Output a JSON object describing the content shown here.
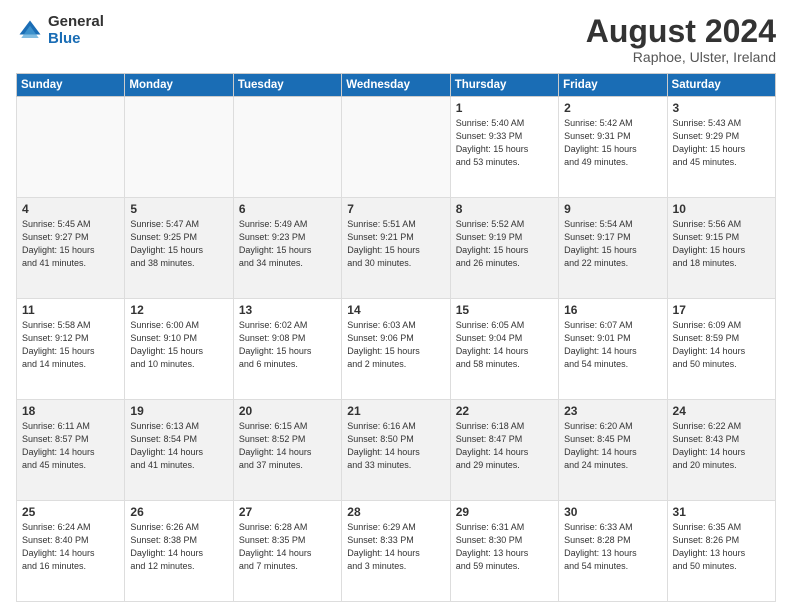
{
  "logo": {
    "general": "General",
    "blue": "Blue"
  },
  "header": {
    "month_year": "August 2024",
    "location": "Raphoe, Ulster, Ireland"
  },
  "weekdays": [
    "Sunday",
    "Monday",
    "Tuesday",
    "Wednesday",
    "Thursday",
    "Friday",
    "Saturday"
  ],
  "weeks": [
    [
      {
        "day": "",
        "info": ""
      },
      {
        "day": "",
        "info": ""
      },
      {
        "day": "",
        "info": ""
      },
      {
        "day": "",
        "info": ""
      },
      {
        "day": "1",
        "info": "Sunrise: 5:40 AM\nSunset: 9:33 PM\nDaylight: 15 hours\nand 53 minutes."
      },
      {
        "day": "2",
        "info": "Sunrise: 5:42 AM\nSunset: 9:31 PM\nDaylight: 15 hours\nand 49 minutes."
      },
      {
        "day": "3",
        "info": "Sunrise: 5:43 AM\nSunset: 9:29 PM\nDaylight: 15 hours\nand 45 minutes."
      }
    ],
    [
      {
        "day": "4",
        "info": "Sunrise: 5:45 AM\nSunset: 9:27 PM\nDaylight: 15 hours\nand 41 minutes."
      },
      {
        "day": "5",
        "info": "Sunrise: 5:47 AM\nSunset: 9:25 PM\nDaylight: 15 hours\nand 38 minutes."
      },
      {
        "day": "6",
        "info": "Sunrise: 5:49 AM\nSunset: 9:23 PM\nDaylight: 15 hours\nand 34 minutes."
      },
      {
        "day": "7",
        "info": "Sunrise: 5:51 AM\nSunset: 9:21 PM\nDaylight: 15 hours\nand 30 minutes."
      },
      {
        "day": "8",
        "info": "Sunrise: 5:52 AM\nSunset: 9:19 PM\nDaylight: 15 hours\nand 26 minutes."
      },
      {
        "day": "9",
        "info": "Sunrise: 5:54 AM\nSunset: 9:17 PM\nDaylight: 15 hours\nand 22 minutes."
      },
      {
        "day": "10",
        "info": "Sunrise: 5:56 AM\nSunset: 9:15 PM\nDaylight: 15 hours\nand 18 minutes."
      }
    ],
    [
      {
        "day": "11",
        "info": "Sunrise: 5:58 AM\nSunset: 9:12 PM\nDaylight: 15 hours\nand 14 minutes."
      },
      {
        "day": "12",
        "info": "Sunrise: 6:00 AM\nSunset: 9:10 PM\nDaylight: 15 hours\nand 10 minutes."
      },
      {
        "day": "13",
        "info": "Sunrise: 6:02 AM\nSunset: 9:08 PM\nDaylight: 15 hours\nand 6 minutes."
      },
      {
        "day": "14",
        "info": "Sunrise: 6:03 AM\nSunset: 9:06 PM\nDaylight: 15 hours\nand 2 minutes."
      },
      {
        "day": "15",
        "info": "Sunrise: 6:05 AM\nSunset: 9:04 PM\nDaylight: 14 hours\nand 58 minutes."
      },
      {
        "day": "16",
        "info": "Sunrise: 6:07 AM\nSunset: 9:01 PM\nDaylight: 14 hours\nand 54 minutes."
      },
      {
        "day": "17",
        "info": "Sunrise: 6:09 AM\nSunset: 8:59 PM\nDaylight: 14 hours\nand 50 minutes."
      }
    ],
    [
      {
        "day": "18",
        "info": "Sunrise: 6:11 AM\nSunset: 8:57 PM\nDaylight: 14 hours\nand 45 minutes."
      },
      {
        "day": "19",
        "info": "Sunrise: 6:13 AM\nSunset: 8:54 PM\nDaylight: 14 hours\nand 41 minutes."
      },
      {
        "day": "20",
        "info": "Sunrise: 6:15 AM\nSunset: 8:52 PM\nDaylight: 14 hours\nand 37 minutes."
      },
      {
        "day": "21",
        "info": "Sunrise: 6:16 AM\nSunset: 8:50 PM\nDaylight: 14 hours\nand 33 minutes."
      },
      {
        "day": "22",
        "info": "Sunrise: 6:18 AM\nSunset: 8:47 PM\nDaylight: 14 hours\nand 29 minutes."
      },
      {
        "day": "23",
        "info": "Sunrise: 6:20 AM\nSunset: 8:45 PM\nDaylight: 14 hours\nand 24 minutes."
      },
      {
        "day": "24",
        "info": "Sunrise: 6:22 AM\nSunset: 8:43 PM\nDaylight: 14 hours\nand 20 minutes."
      }
    ],
    [
      {
        "day": "25",
        "info": "Sunrise: 6:24 AM\nSunset: 8:40 PM\nDaylight: 14 hours\nand 16 minutes."
      },
      {
        "day": "26",
        "info": "Sunrise: 6:26 AM\nSunset: 8:38 PM\nDaylight: 14 hours\nand 12 minutes."
      },
      {
        "day": "27",
        "info": "Sunrise: 6:28 AM\nSunset: 8:35 PM\nDaylight: 14 hours\nand 7 minutes."
      },
      {
        "day": "28",
        "info": "Sunrise: 6:29 AM\nSunset: 8:33 PM\nDaylight: 14 hours\nand 3 minutes."
      },
      {
        "day": "29",
        "info": "Sunrise: 6:31 AM\nSunset: 8:30 PM\nDaylight: 13 hours\nand 59 minutes."
      },
      {
        "day": "30",
        "info": "Sunrise: 6:33 AM\nSunset: 8:28 PM\nDaylight: 13 hours\nand 54 minutes."
      },
      {
        "day": "31",
        "info": "Sunrise: 6:35 AM\nSunset: 8:26 PM\nDaylight: 13 hours\nand 50 minutes."
      }
    ]
  ]
}
